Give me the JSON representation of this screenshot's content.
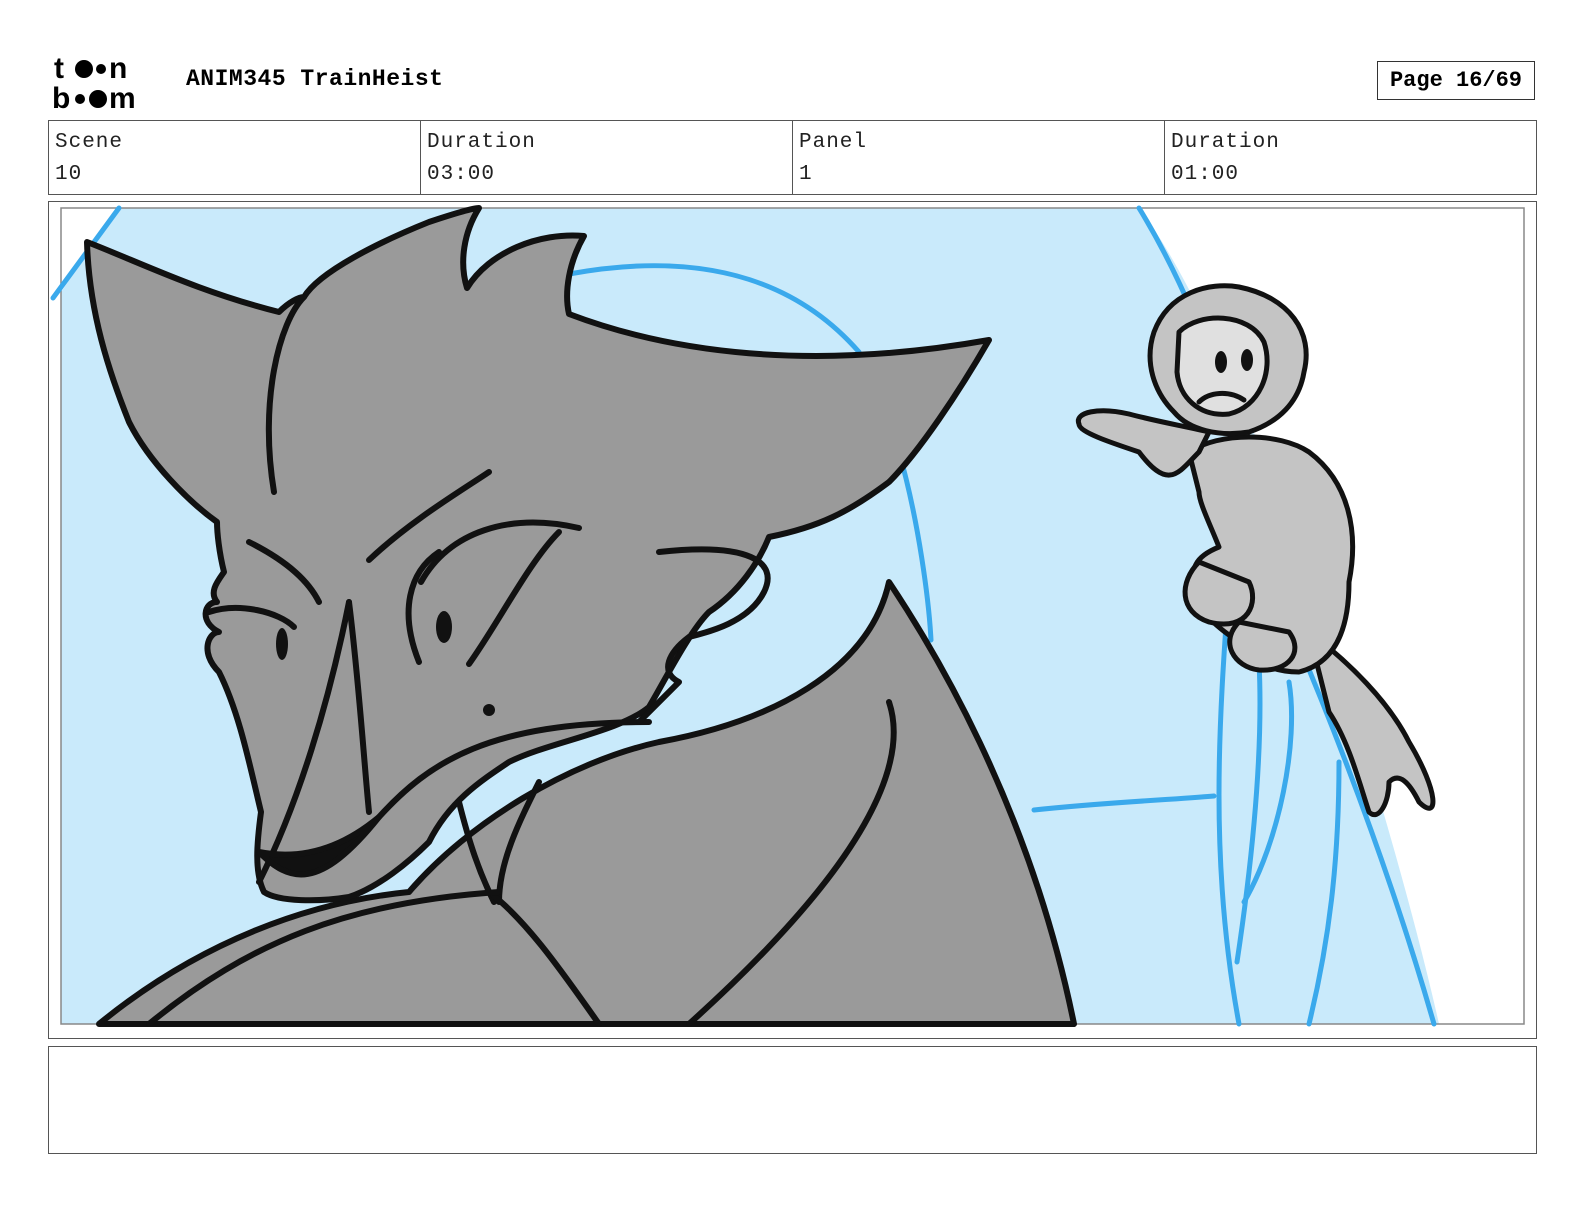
{
  "header": {
    "project_title": "ANIM345 TrainHeist",
    "page_label": "Page 16/69",
    "logo": {
      "name": "toon-boom-logo",
      "text_line1": "toon",
      "text_line2": "boom"
    }
  },
  "info": {
    "scene_label": "Scene",
    "scene_value": "10",
    "scene_duration_label": "Duration",
    "scene_duration_value": "03:00",
    "panel_label": "Panel",
    "panel_value": "1",
    "panel_duration_label": "Duration",
    "panel_duration_value": "01:00"
  },
  "panel_image": {
    "description_icon": "storyboard-sketch-wolf-and-monkey",
    "colors": {
      "sky": "#c9eafb",
      "guide_lines": "#3aa9ec",
      "wolf_fill": "#9a9a9a",
      "monkey_fill": "#c4c4c4",
      "ink": "#111111"
    }
  },
  "notes": {
    "text": ""
  }
}
